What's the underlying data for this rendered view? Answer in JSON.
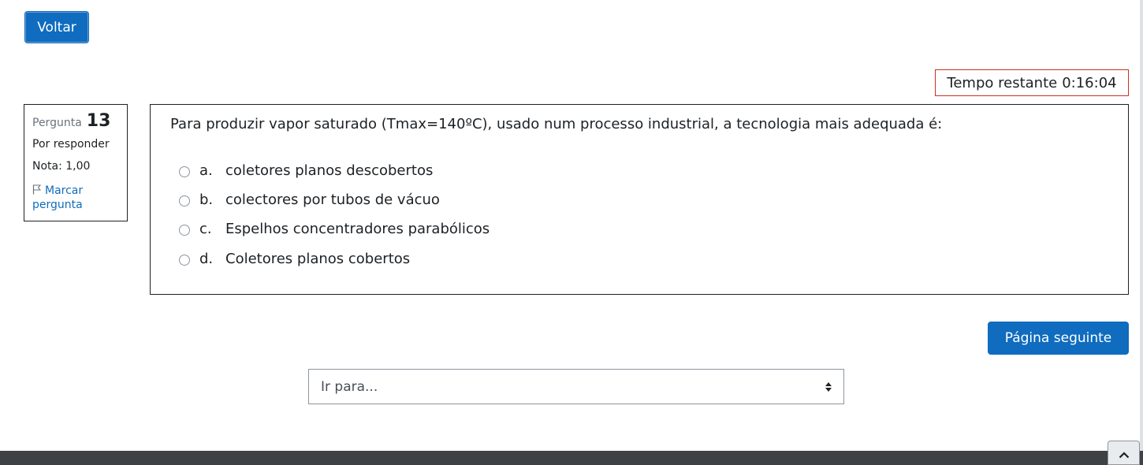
{
  "nav": {
    "back_label": "Voltar",
    "next_label": "Página seguinte"
  },
  "timer": {
    "label": "Tempo restante",
    "value": "0:16:04"
  },
  "question_info": {
    "prefix": "Pergunta",
    "number": "13",
    "state": "Por responder",
    "grade": "Nota: 1,00",
    "flag_label": "Marcar pergunta"
  },
  "question": {
    "text": "Para produzir vapor saturado (Tmax=140ºC), usado num processo industrial, a tecnologia mais adequada é:",
    "answers": [
      {
        "letter": "a.",
        "text": "coletores planos descobertos"
      },
      {
        "letter": "b.",
        "text": "colectores por tubos de vácuo"
      },
      {
        "letter": "c.",
        "text": "Espelhos concentradores parabólicos"
      },
      {
        "letter": "d.",
        "text": "Coletores planos cobertos"
      }
    ]
  },
  "jump": {
    "selected": "Ir para..."
  },
  "icons": {
    "flag": "flag-icon",
    "select_caret": "sort-caret-icon",
    "back_to_top": "chevron-up-icon"
  },
  "colors": {
    "primary": "#0f6cbf",
    "timer_border": "#ca3120",
    "footer": "#3f4244"
  }
}
